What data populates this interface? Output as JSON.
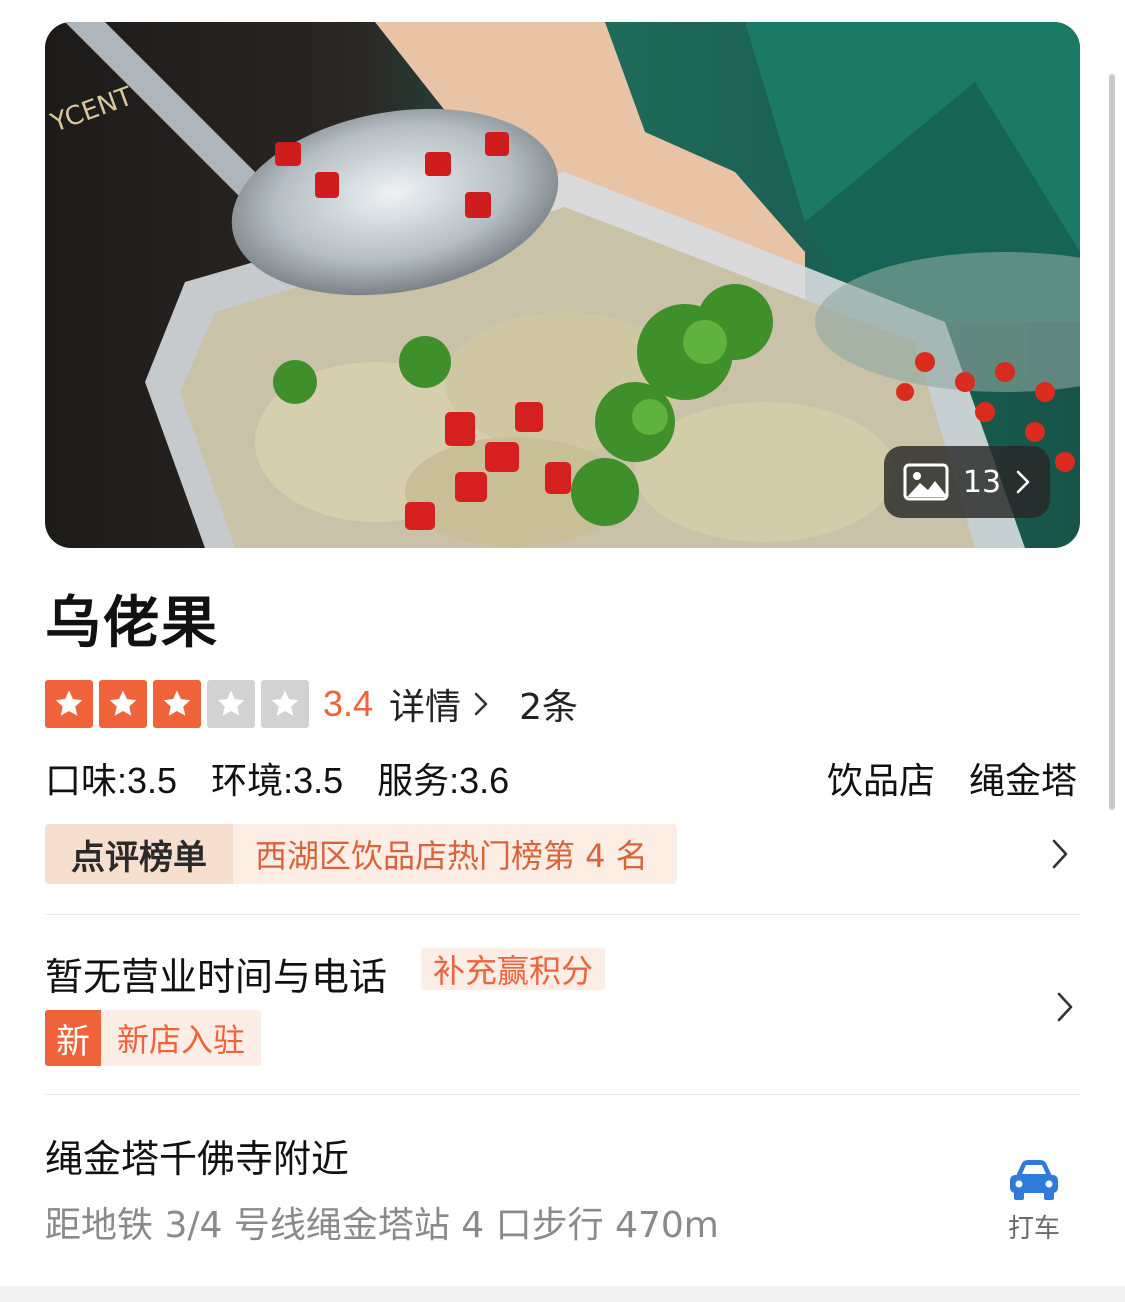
{
  "hero": {
    "photo_count": "13"
  },
  "shop": {
    "name": "乌佬果"
  },
  "rating": {
    "stars_filled": 3,
    "stars_total": 5,
    "score": "3.4",
    "detail_label": "详情",
    "review_count": "2条"
  },
  "subscores": {
    "taste": "口味:3.5",
    "environment": "环境:3.5",
    "service": "服务:3.6"
  },
  "tags": {
    "category": "饮品店",
    "area": "绳金塔"
  },
  "ranking": {
    "label": "点评榜单",
    "text": "西湖区饮品店热门榜第 4 名"
  },
  "hours": {
    "text": "暂无营业时间与电话",
    "points_tag": "补充赢积分",
    "new_badge": "新",
    "new_text": "新店入驻"
  },
  "address": {
    "title": "绳金塔千佛寺附近",
    "subway": "距地铁 3/4 号线绳金塔站 4 口步行 470m",
    "taxi_label": "打车"
  },
  "colors": {
    "accent": "#f0623a",
    "tag_bg": "#fdeee5",
    "muted_text": "#8a8a8a"
  }
}
